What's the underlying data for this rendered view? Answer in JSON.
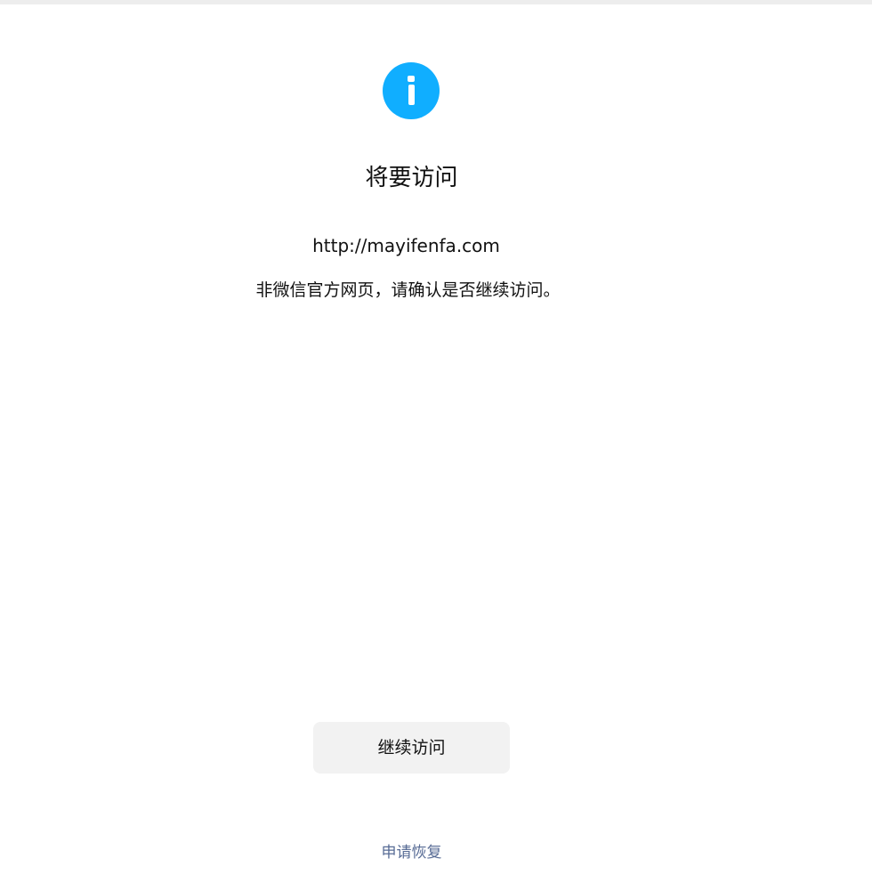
{
  "colors": {
    "icon": "#10aeff",
    "link": "#576b95",
    "button_bg": "#f2f2f2",
    "text": "#111111"
  },
  "icon": "info-icon",
  "title": "将要访问",
  "url": "http://mayifenfa.com",
  "description": "非微信官方网页，请确认是否继续访问。",
  "continue_button": "继续访问",
  "restore_link": "申请恢复"
}
